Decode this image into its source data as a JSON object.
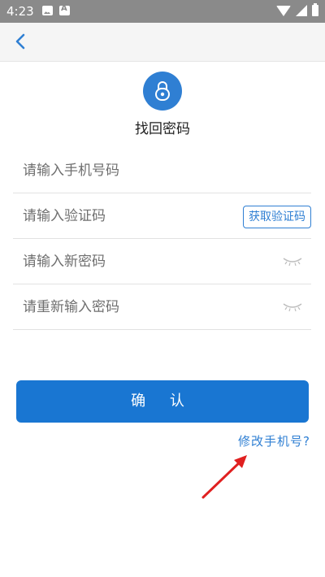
{
  "status_bar": {
    "time": "4:23"
  },
  "page": {
    "title": "找回密码"
  },
  "form": {
    "phone_placeholder": "请输入手机号码",
    "code_placeholder": "请输入验证码",
    "get_code_label": "获取验证码",
    "new_password_placeholder": "请输入新密码",
    "confirm_password_placeholder": "请重新输入密码"
  },
  "actions": {
    "confirm_label": "确 认",
    "change_phone_label": "修改手机号?"
  },
  "colors": {
    "accent": "#1976d2",
    "link": "#2f7fd3",
    "annotation_arrow": "#e02020",
    "status_bar": "#8a8a8a"
  },
  "icons": [
    "back-arrow-icon",
    "lock-icon",
    "eye-closed-icon",
    "wifi-icon",
    "signal-icon",
    "battery-icon"
  ]
}
